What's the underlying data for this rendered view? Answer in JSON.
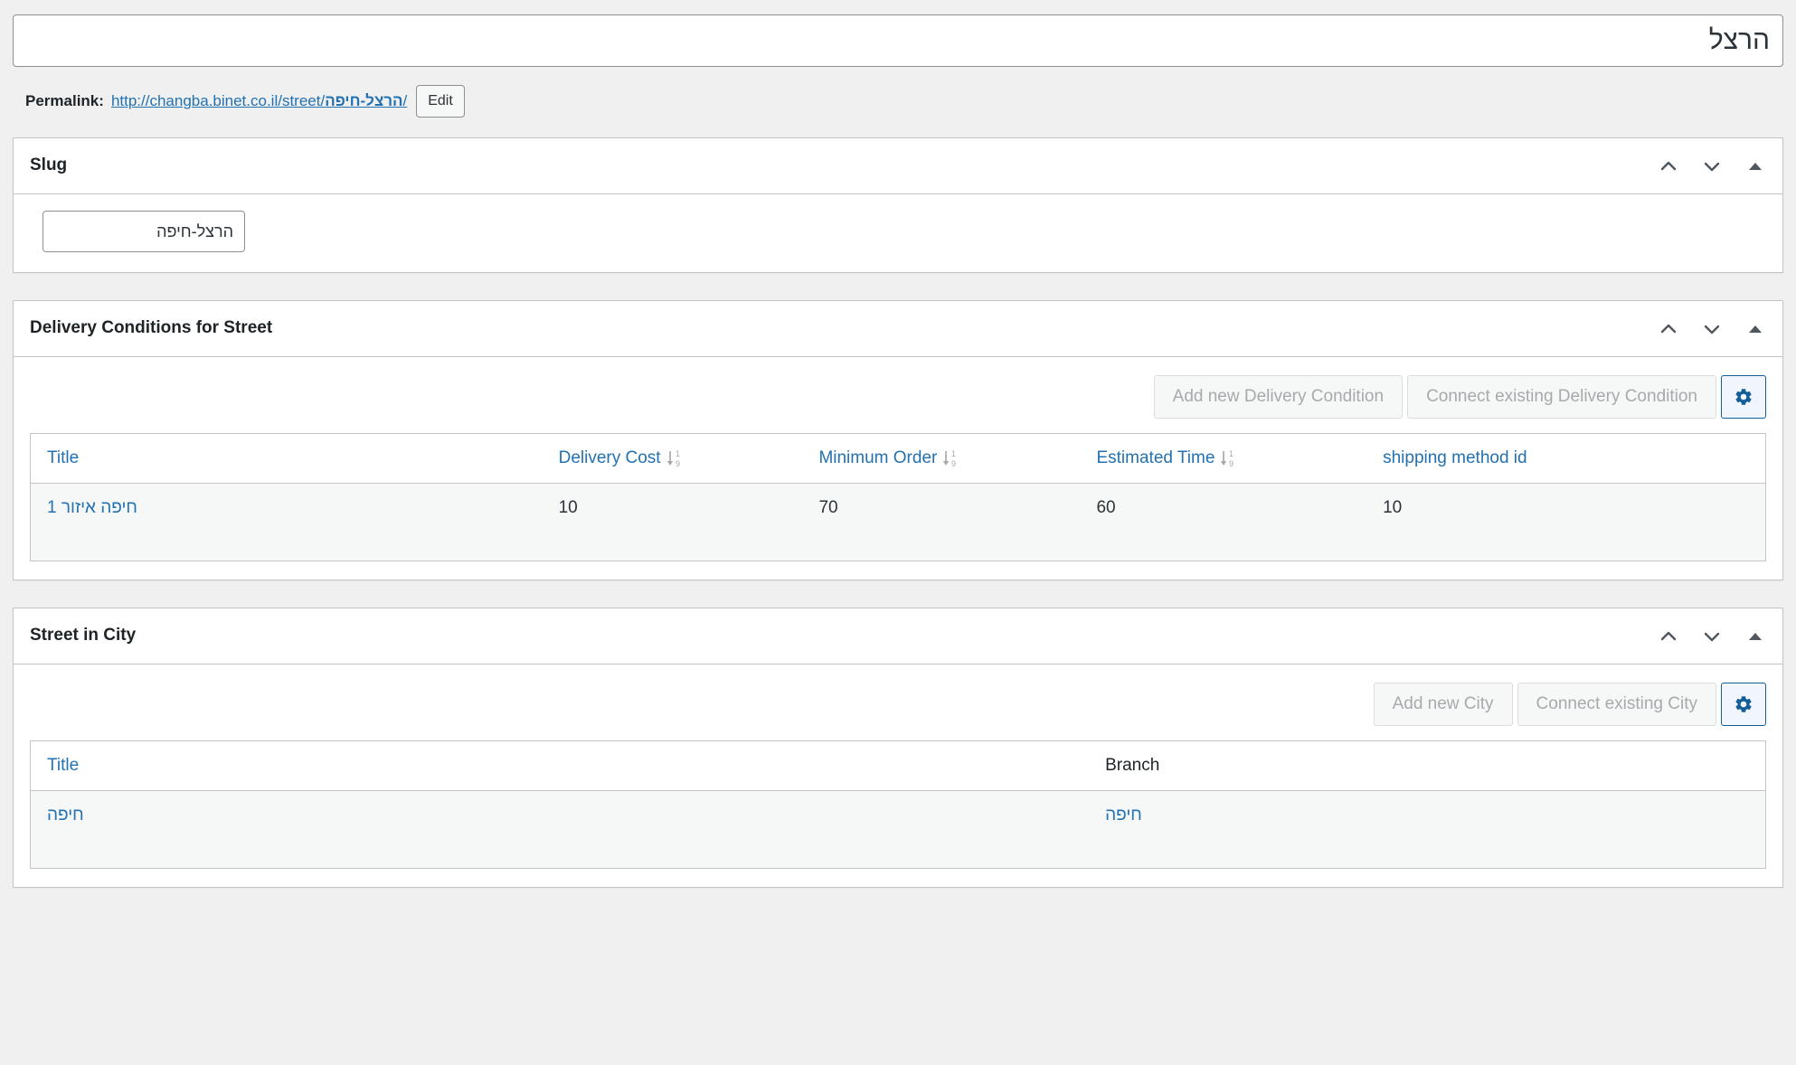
{
  "post": {
    "title_value": "הרצל",
    "title_placeholder": "Add title"
  },
  "permalink": {
    "label": "Permalink:",
    "url_prefix": "http://changba.binet.co.il/street/",
    "url_slug": "הרצל-חיפה",
    "url_suffix": "/",
    "edit_label": "Edit"
  },
  "panels": {
    "slug": {
      "title": "Slug",
      "slug_value": "הרצל-חיפה"
    },
    "delivery": {
      "title": "Delivery Conditions for Street",
      "add_label": "Add new Delivery Condition",
      "connect_label": "Connect existing Delivery Condition",
      "settings_icon": "gear-icon",
      "columns": [
        {
          "label": "Title",
          "sortable": false
        },
        {
          "label": "Delivery Cost",
          "sortable": true
        },
        {
          "label": "Minimum Order",
          "sortable": true
        },
        {
          "label": "Estimated Time",
          "sortable": true
        },
        {
          "label": "shipping method id",
          "sortable": false
        }
      ],
      "rows": [
        {
          "title": "חיפה איזור 1",
          "delivery_cost": "10",
          "minimum_order": "70",
          "estimated_time": "60",
          "shipping_method_id": "10"
        }
      ]
    },
    "city": {
      "title": "Street in City",
      "add_label": "Add new City",
      "connect_label": "Connect existing City",
      "settings_icon": "gear-icon",
      "columns": [
        {
          "label": "Title",
          "link": true
        },
        {
          "label": "Branch",
          "link": false
        }
      ],
      "rows": [
        {
          "title": "חיפה",
          "branch": "חיפה"
        }
      ]
    }
  },
  "icons": {
    "move_up": "chevron-up-icon",
    "move_down": "chevron-down-icon",
    "toggle": "triangle-up-icon",
    "sort": "sort-numeric-desc-icon"
  },
  "colors": {
    "link": "#2271b1",
    "accent_border": "#135e96",
    "page_bg": "#f0f0f1",
    "panel_border": "#c3c4c7",
    "muted_text": "#a7aaad"
  }
}
